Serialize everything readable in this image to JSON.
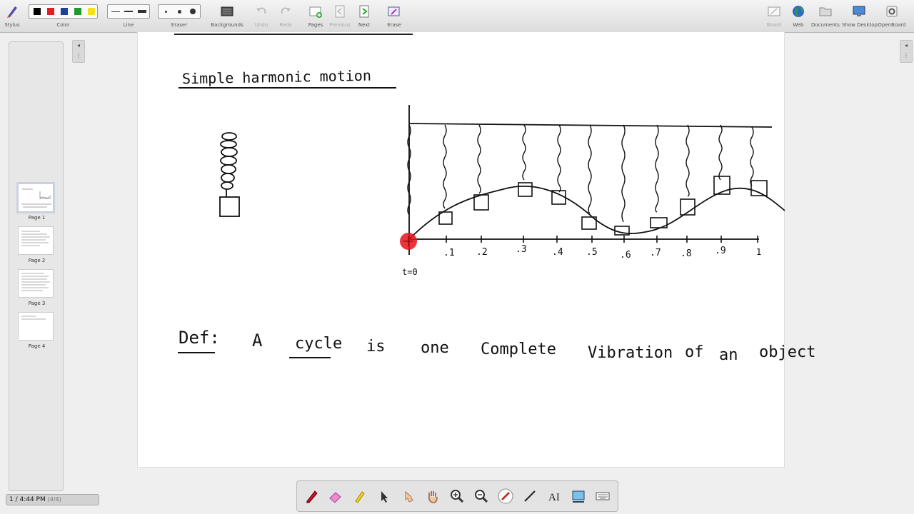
{
  "toolbar": {
    "stylus": "Stylus",
    "color": "Color",
    "line": "Line",
    "eraser": "Eraser",
    "backgrounds": "Backgrounds",
    "undo": "Undo",
    "redo": "Redo",
    "pages": "Pages",
    "previous": "Previous",
    "next": "Next",
    "erase": "Erase",
    "board": "Board",
    "web": "Web",
    "documents": "Documents",
    "show_desktop": "Show Desktop",
    "openboard": "OpenBoard"
  },
  "colors": {
    "black": "#000000",
    "red": "#e0201c",
    "blue": "#1e3f9a",
    "green": "#1f9a2f",
    "yellow": "#f2e21a",
    "pointer": "#e8101a"
  },
  "pages": [
    {
      "label": "Page 1"
    },
    {
      "label": "Page 2"
    },
    {
      "label": "Page 3"
    },
    {
      "label": "Page 4"
    }
  ],
  "board": {
    "title": "Simple harmonic motion",
    "axis_ticks": [
      ".1",
      ".2",
      ".3",
      ".4",
      ".5",
      ".6",
      ".7",
      ".8",
      ".9",
      "1"
    ],
    "t_label": "t=0",
    "definition": {
      "prefix": "Def:",
      "w1": "A",
      "w2": "cycle",
      "w3": "is",
      "w4": "one",
      "w5": "Complete",
      "w6": "Vibration",
      "w7": "of",
      "w8": "an",
      "w9": "object"
    }
  },
  "bottom_tools": [
    "pen-icon",
    "eraser-icon",
    "highlighter-icon",
    "pointer-icon",
    "play-icon",
    "hand-icon",
    "zoom-in-icon",
    "zoom-out-icon",
    "laser-pointer-icon",
    "line-icon",
    "text-icon",
    "capture-icon",
    "keyboard-icon"
  ],
  "clock": {
    "time": "1 / 4:44 PM",
    "page": "(4/4)"
  }
}
